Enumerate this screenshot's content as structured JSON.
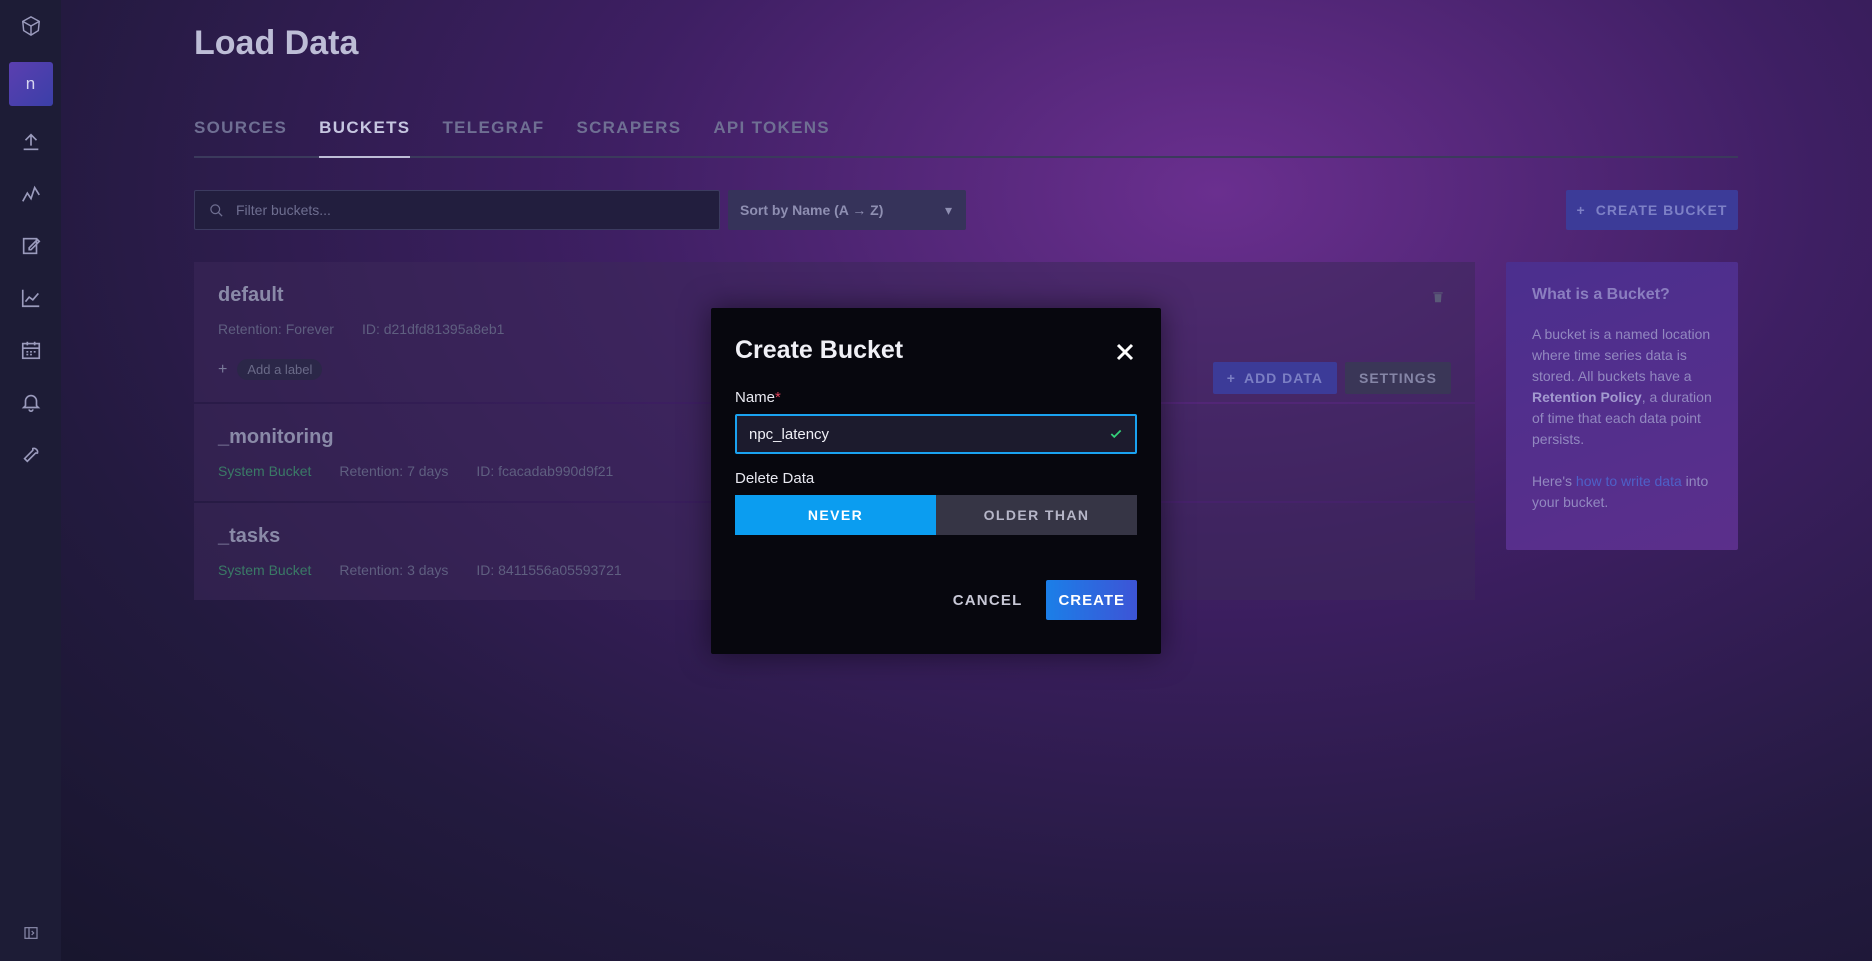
{
  "sidebar": {
    "avatar_initial": "n",
    "items": [
      {
        "icon": "logo-icon"
      },
      {
        "icon": "upload-icon"
      },
      {
        "icon": "data-explorer-icon"
      },
      {
        "icon": "notebook-icon"
      },
      {
        "icon": "dashboard-icon"
      },
      {
        "icon": "calendar-icon"
      },
      {
        "icon": "bell-icon"
      },
      {
        "icon": "wrench-icon"
      }
    ],
    "bottom_icon": "collapse-sidebar-icon"
  },
  "page": {
    "title": "Load Data"
  },
  "tabs": [
    {
      "label": "SOURCES",
      "active": false
    },
    {
      "label": "BUCKETS",
      "active": true
    },
    {
      "label": "TELEGRAF",
      "active": false
    },
    {
      "label": "SCRAPERS",
      "active": false
    },
    {
      "label": "API TOKENS",
      "active": false
    }
  ],
  "filter": {
    "placeholder": "Filter buckets..."
  },
  "sort": {
    "value": "Sort by Name (A → Z)"
  },
  "create_bucket_button": "CREATE BUCKET",
  "buckets": [
    {
      "name": "default",
      "retention": "Retention: Forever",
      "id": "ID: d21dfd81395a8eb1",
      "add_label": "Add a label",
      "add_data": "ADD DATA",
      "settings": "SETTINGS"
    },
    {
      "name": "_monitoring",
      "system": "System Bucket",
      "retention": "Retention: 7 days",
      "id": "ID: fcacadab990d9f21"
    },
    {
      "name": "_tasks",
      "system": "System Bucket",
      "retention": "Retention: 3 days",
      "id": "ID: 8411556a05593721"
    }
  ],
  "info_panel": {
    "title": "What is a Bucket?",
    "text_1": "A bucket is a named location where time series data is stored. All buckets have a",
    "text_bold": "Retention Policy",
    "text_2": ", a duration of time that each data point persists.",
    "text_3": "Here's",
    "link": "how to write data",
    "text_4": "into your bucket."
  },
  "modal": {
    "title": "Create Bucket",
    "name_label": "Name",
    "required_mark": "*",
    "name_value": "npc_latency",
    "delete_label": "Delete Data",
    "delete_options": [
      "NEVER",
      "OLDER THAN"
    ],
    "delete_selected": "NEVER",
    "cancel": "CANCEL",
    "create": "CREATE"
  },
  "colors": {
    "accent": "#0b9df0",
    "create_gradient_start": "#1b7fe8",
    "create_gradient_end": "#3d54d6",
    "required": "#e0435b",
    "valid_check": "#34d17a"
  }
}
